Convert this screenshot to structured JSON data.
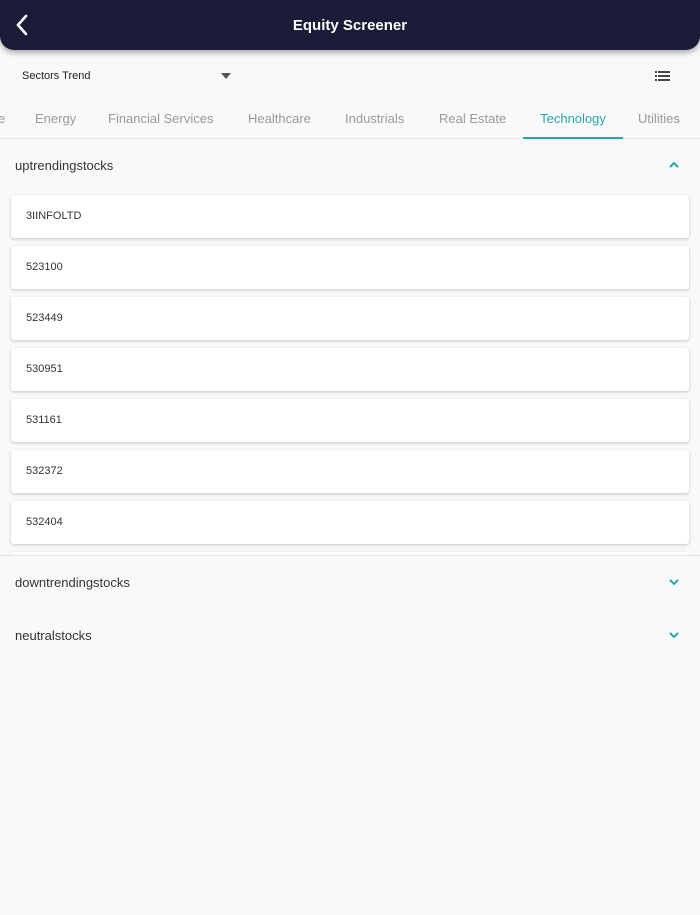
{
  "header": {
    "title": "Equity Screener"
  },
  "dropdown": {
    "value": "Sectors Trend"
  },
  "tabs": [
    {
      "label": "e"
    },
    {
      "label": "Energy"
    },
    {
      "label": "Financial Services"
    },
    {
      "label": "Healthcare"
    },
    {
      "label": "Industrials"
    },
    {
      "label": "Real Estate"
    },
    {
      "label": "Technology",
      "active": true
    },
    {
      "label": "Utilities"
    }
  ],
  "sections": {
    "uptrending": {
      "label": "uptrendingstocks",
      "expanded": true,
      "items": [
        "3IINFOLTD",
        "523100",
        "523449",
        "530951",
        "531161",
        "532372",
        "532404",
        ""
      ]
    },
    "downtrending": {
      "label": "downtrendingstocks",
      "expanded": false
    },
    "neutral": {
      "label": "neutralstocks",
      "expanded": false
    }
  },
  "colors": {
    "accent": "#2aa5a8",
    "header": "#1a1c38"
  }
}
